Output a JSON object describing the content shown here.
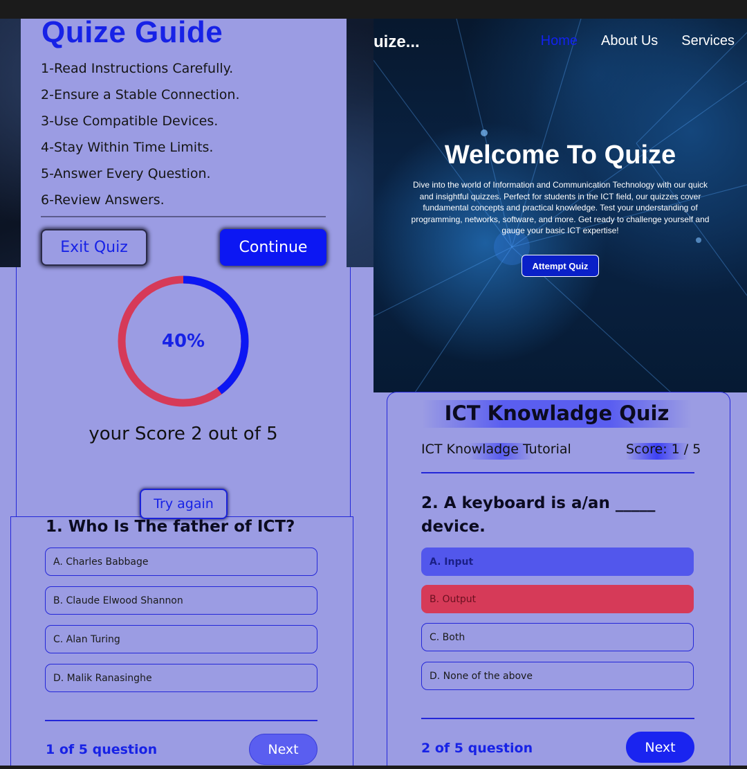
{
  "guide": {
    "title": "Quize Guide",
    "rules": [
      "1-Read Instructions Carefully.",
      "2-Ensure a Stable Connection.",
      "3-Use Compatible Devices.",
      "4-Stay Within Time Limits.",
      "5-Answer Every Question.",
      "6-Review Answers."
    ],
    "exit_label": "Exit Quiz",
    "continue_label": "Continue"
  },
  "hero": {
    "logo": "uize...",
    "nav": [
      "Home",
      "About Us",
      "Services"
    ],
    "active_nav": "Home",
    "title": "Welcome To Quize",
    "description": "Dive into the world of Information and Communication Technology with our quick and insightful quizzes. Perfect for students in the ICT field, our quizzes cover fundamental concepts and practical knowledge. Test your understanding of programming, networks, software, and more. Get ready to challenge yourself and gauge your basic ICT expertise!",
    "attempt_label": "Attempt Quiz"
  },
  "result": {
    "percent": 40,
    "percent_label": "40%",
    "score_text": "your Score 2 out of 5",
    "try_again_label": "Try again",
    "colors": {
      "score": "#0c17f3",
      "remainder": "#d63a58"
    }
  },
  "quiz_left": {
    "question": "1. Who Is The father of ICT?",
    "options": [
      "A. Charles Babbage",
      "B. Claude Elwood Shannon",
      "C. Alan Turing",
      "D. Malik Ranasinghe"
    ],
    "counter": "1 of 5 question",
    "next_label": "Next"
  },
  "quiz_right": {
    "title": "ICT Knowladge Quiz",
    "subtitle": "ICT Knowladge Tutorial",
    "score": "Score: 1 / 5",
    "question_line1": "2. A keyboard is a/an _____",
    "question_line2": "device.",
    "options": [
      {
        "label": "A. Input",
        "state": "correct"
      },
      {
        "label": "B. Output",
        "state": "wrong"
      },
      {
        "label": "C. Both",
        "state": "none"
      },
      {
        "label": "D. None of the above",
        "state": "none"
      }
    ],
    "counter": "2 of 5 question",
    "next_label": "Next"
  },
  "colors": {
    "background": "#9b9ce3",
    "accent": "#1722e6",
    "correct": "#5257ec",
    "wrong": "#d63a58"
  }
}
